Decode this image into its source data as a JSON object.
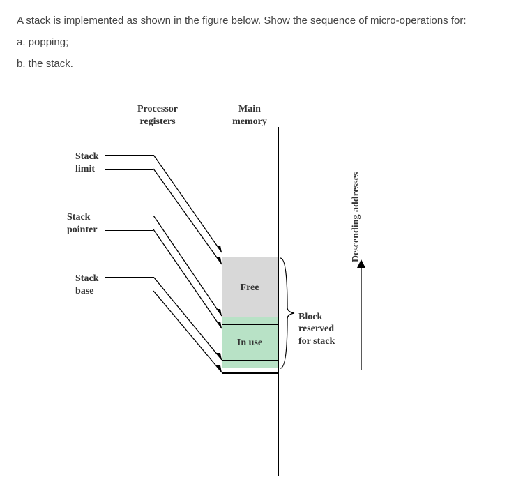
{
  "question": {
    "intro": "A stack is implemented as shown in the figure below. Show the sequence of micro-operations for:",
    "part_a": "a. popping;",
    "part_b": "b. the stack."
  },
  "diagram": {
    "processor_registers_header": "Processor\nregisters",
    "main_memory_header": "Main\nmemory",
    "registers": {
      "stack_limit": "Stack\nlimit",
      "stack_pointer": "Stack\npointer",
      "stack_base": "Stack\nbase"
    },
    "memory_regions": {
      "free": "Free",
      "in_use": "In use"
    },
    "block_label": "Block\nreserved\nfor stack",
    "address_label": "Descending addresses"
  }
}
